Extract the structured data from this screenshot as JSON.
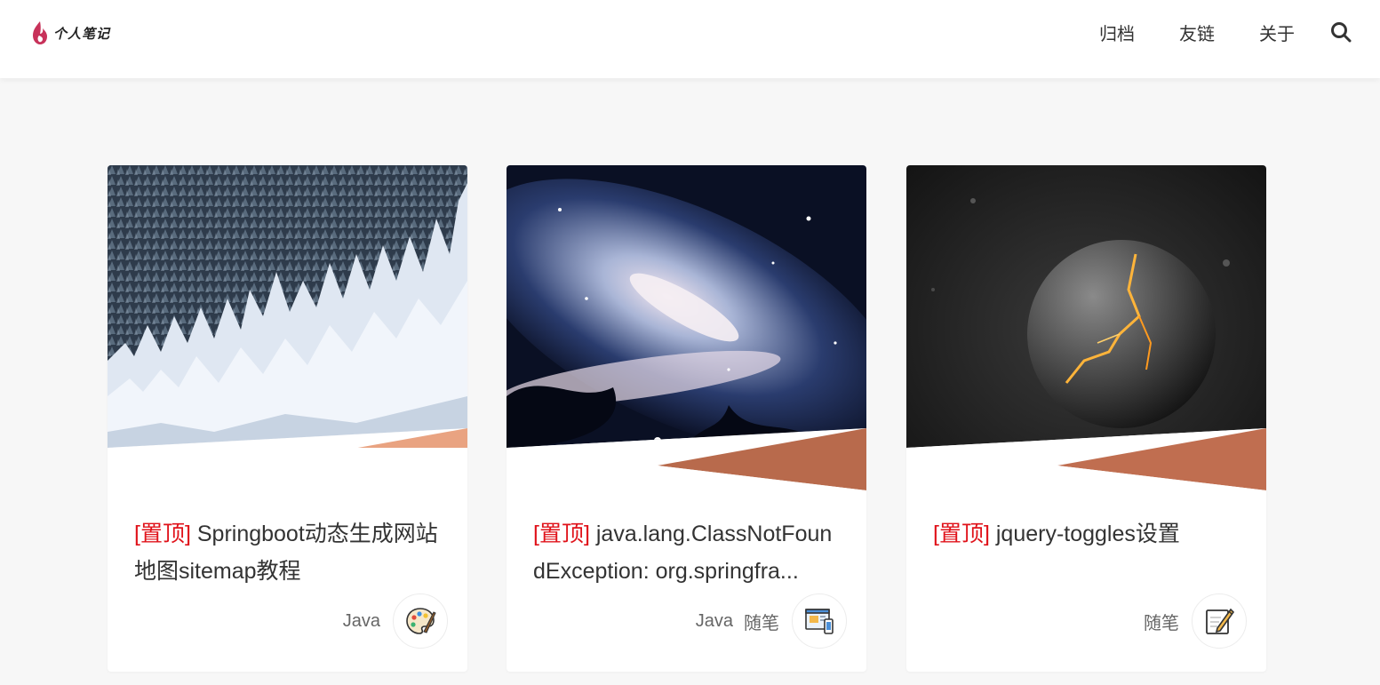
{
  "header": {
    "logo_text": "个人笔记",
    "nav": [
      {
        "label": "归档"
      },
      {
        "label": "友链"
      },
      {
        "label": "关于"
      }
    ]
  },
  "posts": [
    {
      "pin": "[置顶]",
      "title": "Springboot动态生成网站地图sitemap教程",
      "tags": [
        "Java"
      ],
      "category_icon": "palette-icon",
      "image": "snowy-forest"
    },
    {
      "pin": "[置顶]",
      "title": "java.lang.ClassNotFoundException: org.springfra...",
      "tags": [
        "Java",
        "随笔"
      ],
      "category_icon": "window-device-icon",
      "image": "nebula-space"
    },
    {
      "pin": "[置顶]",
      "title": "jquery-toggles设置",
      "tags": [
        "随笔"
      ],
      "category_icon": "edit-note-icon",
      "image": "cracked-planet"
    }
  ],
  "colors": {
    "pin": "#e0121a",
    "accent_stripe": "#c7765a",
    "background": "#f7f7f7"
  }
}
